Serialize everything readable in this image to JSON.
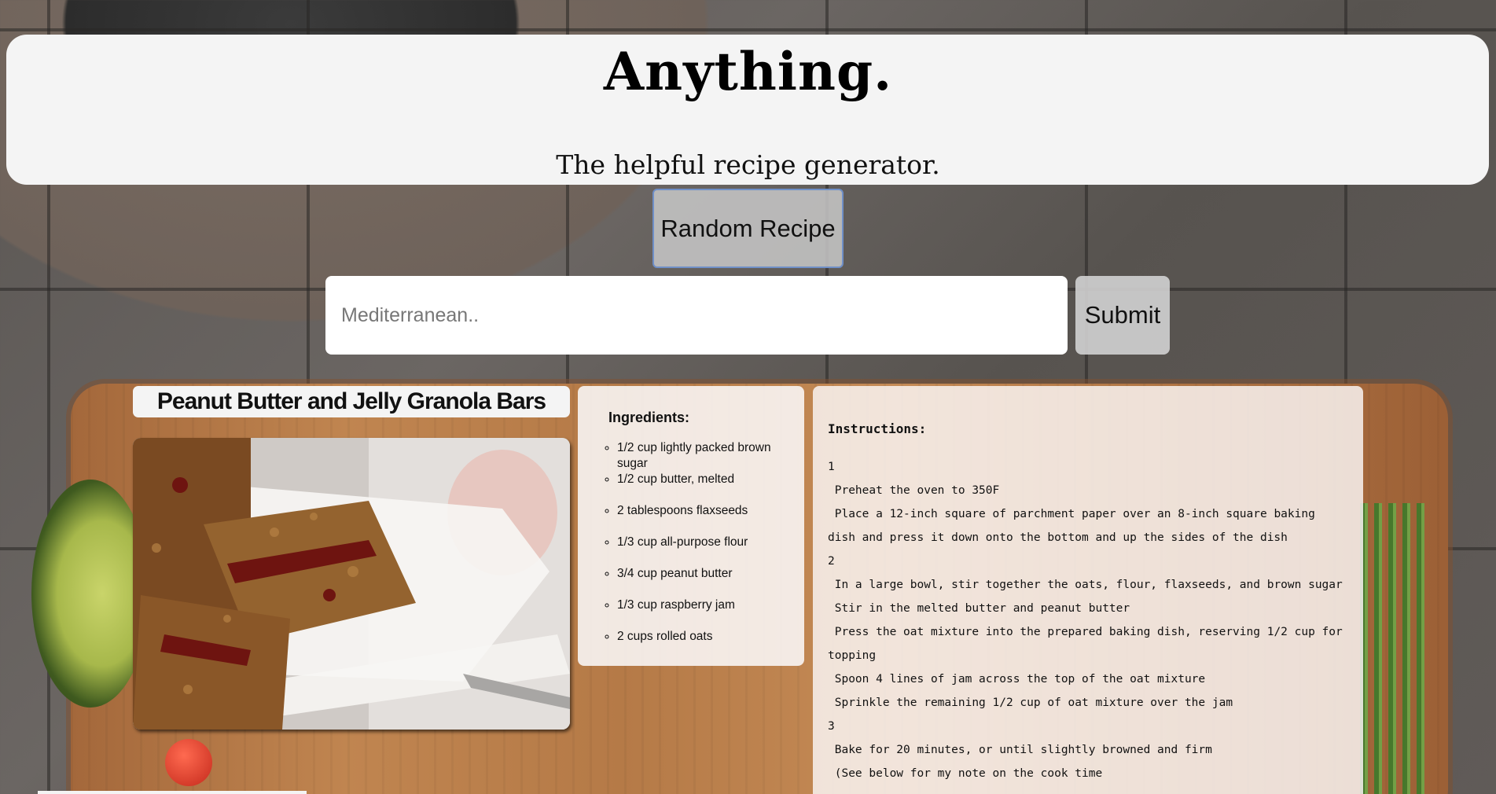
{
  "header": {
    "title": "Anything.",
    "subtitle": "The helpful recipe generator."
  },
  "controls": {
    "random_label": "Random Recipe",
    "search_placeholder": "Mediterranean..",
    "search_value": "",
    "submit_label": "Submit"
  },
  "recipe": {
    "title": "Peanut Butter and Jelly Granola Bars",
    "image_alt": "granola bars with jam",
    "ingredients_heading": "Ingredients:",
    "ingredients": [
      "1/2 cup lightly packed brown sugar",
      "1/2 cup butter, melted",
      "2 tablespoons flaxseeds",
      "1/3 cup all-purpose flour",
      "3/4 cup peanut butter",
      "1/3 cup raspberry jam",
      "2 cups rolled oats"
    ],
    "instructions_heading": "Instructions:",
    "instructions": [
      "1",
      " Preheat the oven to 350F",
      " Place a 12-inch square of parchment paper over an 8-inch square baking dish and press it down onto the bottom and up the sides of the dish",
      "2",
      " In a large bowl, stir together the oats, flour, flaxseeds, and brown sugar",
      " Stir in the melted butter and peanut butter",
      " Press the oat mixture into the prepared baking dish, reserving 1/2 cup for topping",
      " Spoon 4 lines of jam across the top of the oat mixture",
      " Sprinkle the remaining 1/2 cup of oat mixture over the jam",
      "3",
      " Bake for 20 minutes, or until slightly browned and firm",
      " (See below for my note on the cook time"
    ]
  },
  "colors": {
    "panel": "#f4f4f4",
    "button_border": "#6f8fc7"
  }
}
